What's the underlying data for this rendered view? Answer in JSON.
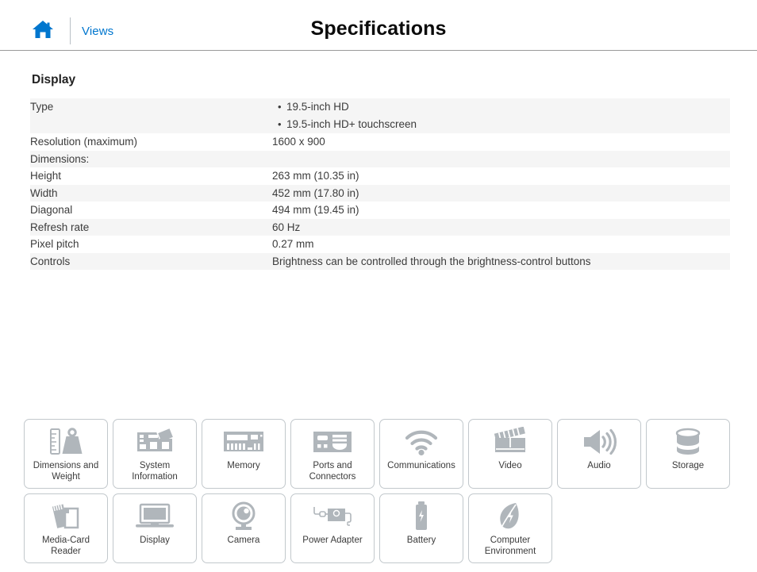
{
  "header": {
    "home_icon": "home-icon",
    "views_label": "Views",
    "title": "Specifications"
  },
  "section": {
    "title": "Display"
  },
  "spec_rows": [
    {
      "key": "Type",
      "indent": false,
      "bullets": [
        "19.5-inch HD",
        "19.5-inch HD+ touchscreen"
      ]
    },
    {
      "key": "Resolution (maximum)",
      "indent": false,
      "value": "1600 x 900"
    },
    {
      "key": "Dimensions:",
      "indent": false,
      "value": ""
    },
    {
      "key": "Height",
      "indent": true,
      "value": "263 mm (10.35 in)"
    },
    {
      "key": "Width",
      "indent": true,
      "value": "452 mm (17.80 in)"
    },
    {
      "key": "Diagonal",
      "indent": true,
      "value": "494 mm (19.45 in)"
    },
    {
      "key": "Refresh rate",
      "indent": false,
      "value": "60 Hz"
    },
    {
      "key": "Pixel pitch",
      "indent": false,
      "value": "0.27 mm"
    },
    {
      "key": "Controls",
      "indent": false,
      "value": "Brightness can be controlled through the brightness-control buttons"
    }
  ],
  "tiles": [
    {
      "label": "Dimensions and\nWeight",
      "icon": "ruler-weight-icon"
    },
    {
      "label": "System\nInformation",
      "icon": "motherboard-icon"
    },
    {
      "label": "Memory",
      "icon": "memory-module-icon"
    },
    {
      "label": "Ports and\nConnectors",
      "icon": "ports-icon"
    },
    {
      "label": "Communications",
      "icon": "wifi-icon"
    },
    {
      "label": "Video",
      "icon": "clapperboard-icon"
    },
    {
      "label": "Audio",
      "icon": "speaker-icon"
    },
    {
      "label": "Storage",
      "icon": "drive-cylinder-icon"
    },
    {
      "label": "Media-Card\nReader",
      "icon": "media-card-icon"
    },
    {
      "label": "Display",
      "icon": "monitor-icon"
    },
    {
      "label": "Camera",
      "icon": "webcam-icon"
    },
    {
      "label": "Power Adapter",
      "icon": "power-adapter-icon"
    },
    {
      "label": "Battery",
      "icon": "battery-icon"
    },
    {
      "label": "Computer\nEnvironment",
      "icon": "leaf-icon"
    }
  ],
  "colors": {
    "accent": "#0076ce",
    "icon_gray": "#b0b6bb",
    "stripe": "#f5f5f5",
    "border": "#c2c8cc"
  }
}
